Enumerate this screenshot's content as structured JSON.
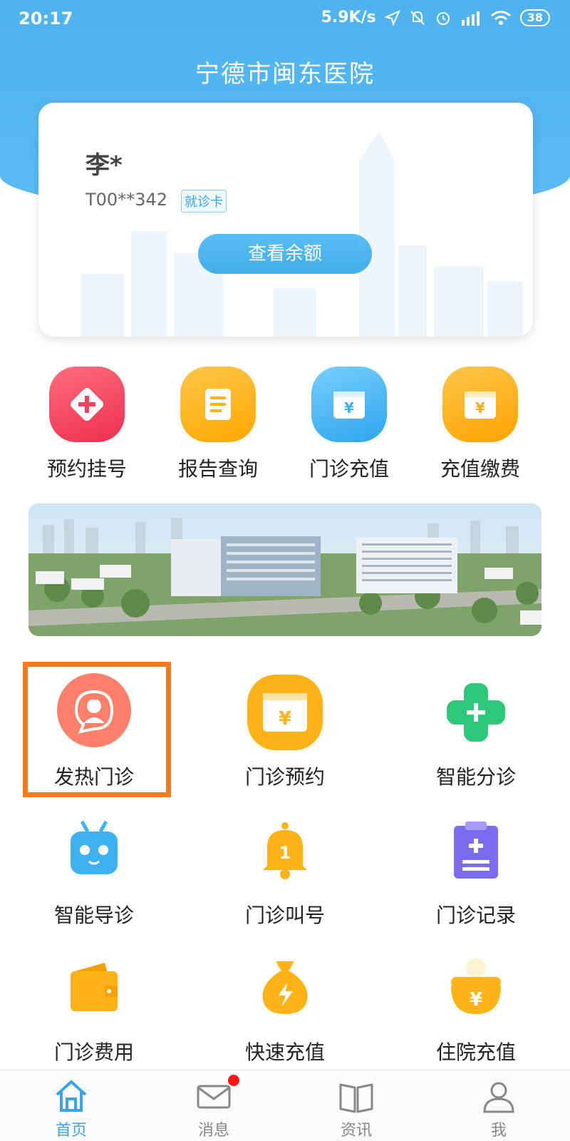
{
  "status_bar": {
    "time": "20:17",
    "net_speed": "5.9K/s",
    "battery": "38"
  },
  "app": {
    "title": "宁德市闽东医院"
  },
  "card": {
    "name": "李*",
    "id": "T00**342",
    "tag": "就诊卡",
    "balance_button": "查看余额"
  },
  "quick_actions": [
    {
      "label": "预约挂号",
      "icon": "plus-diamond-icon",
      "color": "#f2445f"
    },
    {
      "label": "报告查询",
      "icon": "document-icon",
      "color": "#ffb318"
    },
    {
      "label": "门诊充值",
      "icon": "yen-wallet-icon",
      "color": "#3fb1f1"
    },
    {
      "label": "充值缴费",
      "icon": "yen-wallet-icon",
      "color": "#ffad1f"
    }
  ],
  "services": [
    {
      "label": "发热门诊",
      "icon": "nurse-chat-icon",
      "color": "#ff7f6a"
    },
    {
      "label": "门诊预约",
      "icon": "yen-wallet-icon",
      "color": "#ffb318"
    },
    {
      "label": "智能分诊",
      "icon": "green-cross-icon",
      "color": "#2fc879"
    },
    {
      "label": "智能导诊",
      "icon": "robot-icon",
      "color": "#3fb1f1"
    },
    {
      "label": "门诊叫号",
      "icon": "bell-icon",
      "color": "#ffb318"
    },
    {
      "label": "门诊记录",
      "icon": "clipboard-icon",
      "color": "#7b6bf0"
    },
    {
      "label": "门诊费用",
      "icon": "wallet-icon",
      "color": "#ffb318"
    },
    {
      "label": "快速充值",
      "icon": "money-bag-icon",
      "color": "#ffb318"
    },
    {
      "label": "住院充值",
      "icon": "yen-coin-icon",
      "color": "#ffb318"
    }
  ],
  "tabs": [
    {
      "label": "首页",
      "icon": "home-icon",
      "active": true
    },
    {
      "label": "消息",
      "icon": "mail-icon",
      "active": false
    },
    {
      "label": "资讯",
      "icon": "book-icon",
      "active": false
    },
    {
      "label": "我",
      "icon": "user-icon",
      "active": false
    }
  ],
  "colors": {
    "primary": "#4fb2ee",
    "highlight": "#f57a1e",
    "tab_active": "#3aa4e6"
  }
}
